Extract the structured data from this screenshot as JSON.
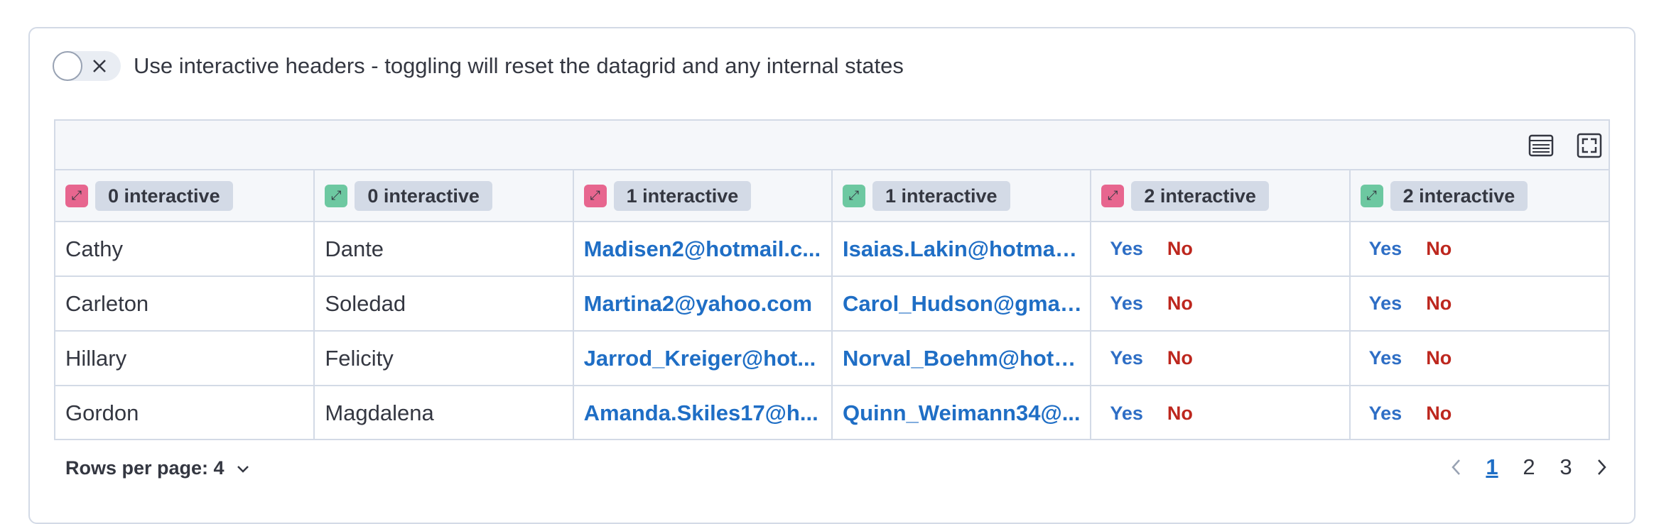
{
  "toggle": {
    "label": "Use interactive headers - toggling will reset the datagrid and any internal states",
    "checked": false
  },
  "toolbar": {
    "icons": [
      "table-density-icon",
      "fullscreen-icon"
    ]
  },
  "columns": [
    {
      "label": "0 interactive",
      "icon_color": "#e7668f"
    },
    {
      "label": "0 interactive",
      "icon_color": "#6dc8a1"
    },
    {
      "label": "1 interactive",
      "icon_color": "#e7668f"
    },
    {
      "label": "1 interactive",
      "icon_color": "#6dc8a1"
    },
    {
      "label": "2 interactive",
      "icon_color": "#e7668f"
    },
    {
      "label": "2 interactive",
      "icon_color": "#6dc8a1"
    }
  ],
  "rows": [
    {
      "c0": "Cathy",
      "c1": "Dante",
      "c2": "Madisen2@hotmail.c...",
      "c3": "Isaias.Lakin@hotmail....",
      "yes": "Yes",
      "no": "No"
    },
    {
      "c0": "Carleton",
      "c1": "Soledad",
      "c2": "Martina2@yahoo.com",
      "c3": "Carol_Hudson@gmail...",
      "yes": "Yes",
      "no": "No"
    },
    {
      "c0": "Hillary",
      "c1": "Felicity",
      "c2": "Jarrod_Kreiger@hot...",
      "c3": "Norval_Boehm@hotm...",
      "yes": "Yes",
      "no": "No"
    },
    {
      "c0": "Gordon",
      "c1": "Magdalena",
      "c2": "Amanda.Skiles17@h...",
      "c3": "Quinn_Weimann34@...",
      "yes": "Yes",
      "no": "No"
    }
  ],
  "footer": {
    "rows_per_page_label": "Rows per page: 4",
    "pages": [
      "1",
      "2",
      "3"
    ],
    "current_page": "1"
  },
  "colors": {
    "link": "#1f6ec5",
    "no": "#bd271e",
    "border": "#d3dae6"
  }
}
